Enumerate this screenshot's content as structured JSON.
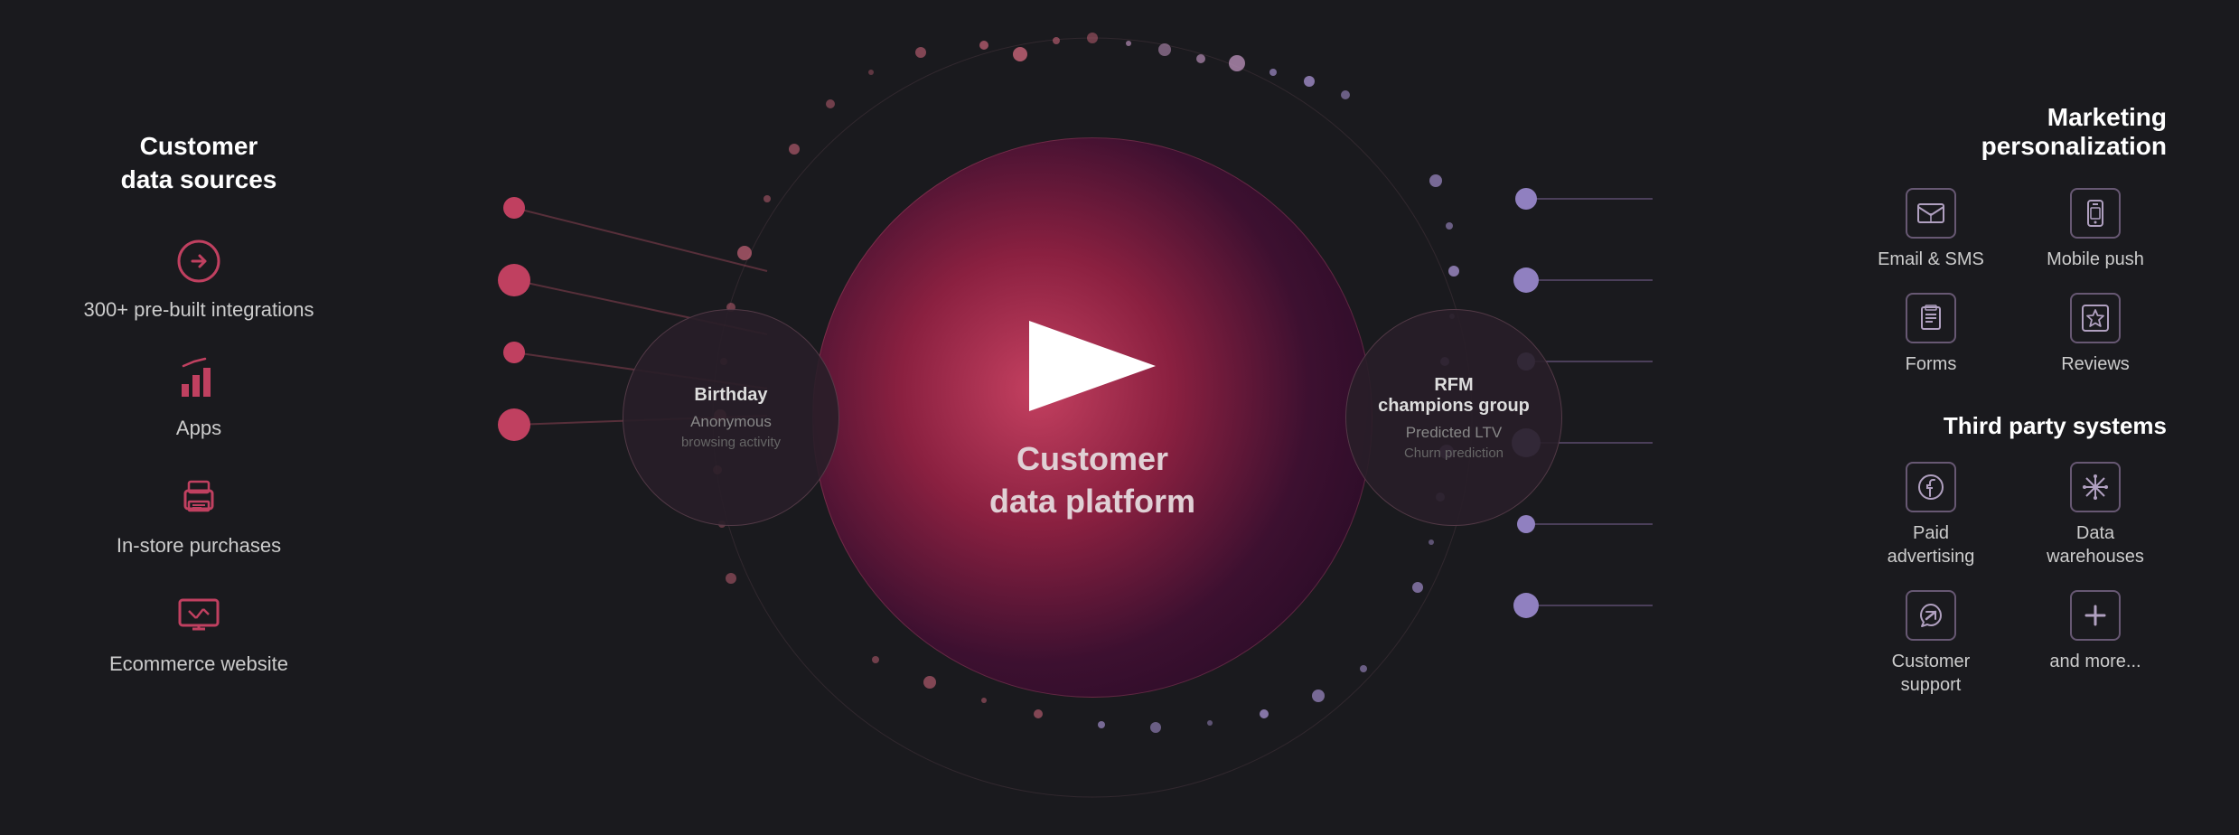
{
  "left_panel": {
    "title": "Customer\ndata sources",
    "items": [
      {
        "id": "integrations",
        "label": "300+ pre-built\nintegrations",
        "icon": "arrow-circle"
      },
      {
        "id": "apps",
        "label": "Apps",
        "icon": "bar-chart"
      },
      {
        "id": "store",
        "label": "In-store\npurchases",
        "icon": "printer"
      },
      {
        "id": "ecommerce",
        "label": "Ecommerce\nwebsite",
        "icon": "screen"
      }
    ]
  },
  "center": {
    "cdp_title": "Customer\ndata platform",
    "left_bubble": {
      "line1": "Birthday",
      "line2": "Anonymous",
      "line3": "browsing activity"
    },
    "right_bubble": {
      "line1": "RFM\nchampions group",
      "line2": "Predicted LTV"
    }
  },
  "right_panel": {
    "marketing_title": "Marketing\npersonalization",
    "marketing_items": [
      {
        "id": "email-sms",
        "label": "Email & SMS",
        "icon": "envelope"
      },
      {
        "id": "mobile-push",
        "label": "Mobile push",
        "icon": "mobile"
      },
      {
        "id": "forms",
        "label": "Forms",
        "icon": "clipboard"
      },
      {
        "id": "reviews",
        "label": "Reviews",
        "icon": "star"
      }
    ],
    "third_party_title": "Third party systems",
    "third_party_items": [
      {
        "id": "paid-advertising",
        "label": "Paid\nadvertising",
        "icon": "facebook"
      },
      {
        "id": "data-warehouses",
        "label": "Data\nwarehouses",
        "icon": "snowflake"
      },
      {
        "id": "customer-support",
        "label": "Customer\nsupport",
        "icon": "zendesk"
      },
      {
        "id": "and-more",
        "label": "and more...",
        "icon": "plus"
      }
    ]
  }
}
